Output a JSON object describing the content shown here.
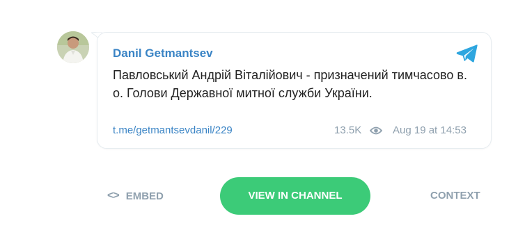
{
  "post": {
    "author": "Danil Getmantsev",
    "text": "Павловський Андрій Віталійович - призначений тимчасово в. о. Голови Державної митної служби України.",
    "link": "t.me/getmantsevdanil/229",
    "views": "13.5K",
    "date": "Aug 19 at 14:53"
  },
  "actions": {
    "embed_label": "EMBED",
    "embed_icon": "code-icon",
    "view_label": "VIEW IN CHANNEL",
    "context_label": "CONTEXT"
  },
  "colors": {
    "accent": "#3a84c5",
    "button": "#3ccb78",
    "muted": "#8fa0ae",
    "telegram": "#2ea6df"
  }
}
